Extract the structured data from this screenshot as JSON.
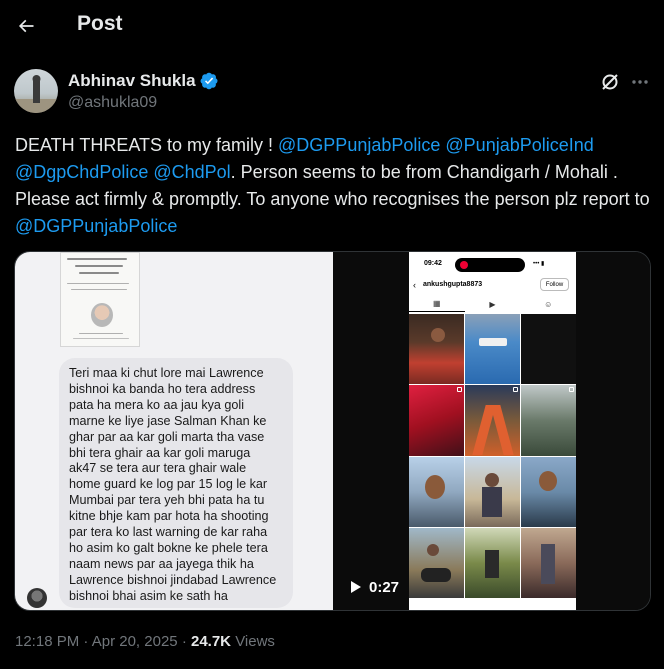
{
  "header": {
    "title": "Post",
    "back_icon": "arrow-left-icon"
  },
  "author": {
    "name": "Abhinav Shukla",
    "handle": "@ashukla09",
    "verified": true
  },
  "tweet": {
    "text_segments": [
      {
        "text": "DEATH THREATS to my family ! ",
        "mention": false
      },
      {
        "text": "@DGPPunjabPolice",
        "mention": true
      },
      {
        "text": " ",
        "mention": false
      },
      {
        "text": "@PunjabPoliceInd",
        "mention": true
      },
      {
        "text": " ",
        "mention": false
      },
      {
        "text": "@DgpChdPolice",
        "mention": true
      },
      {
        "text": " ",
        "mention": false
      },
      {
        "text": "@ChdPol",
        "mention": true
      },
      {
        "text": ". Person seems to be from Chandigarh / Mohali . Please act firmly & promptly.  To anyone who recognises the person plz report to ",
        "mention": false
      },
      {
        "text": "@DGPPunjabPolice",
        "mention": true
      }
    ]
  },
  "media": {
    "chat_message": "Teri maa ki chut lore mai Lawrence\nbishnoi ka banda ho tera address\npata ha mera ko aa jau kya goli\nmarne ke liye jase Salman Khan ke\nghar par aa kar goli marta tha vase\nbhi tera ghair aa kar goli maruga\nak47 se tera aur tera ghair wale\nhome guard ke log par 15 log le kar\nMumbai par tera yeh bhi pata ha tu\nkitne bhje kam par hota ha shooting\npar tera ko last warning de kar raha\nho asim ko galt bokne ke phele tera\nnaam news par aa jayega thik ha\nLawrence bishnoi jindabad Lawrence\nbishnoi bhai asim ke sath ha",
    "phone_time": "09:42",
    "status_icons": "••• ▮",
    "profile_username": "ankushgupta8873",
    "follow_label": "Follow",
    "video_duration": "0:27"
  },
  "meta": {
    "time": "12:18 PM",
    "date": "Apr 20, 2025",
    "views_count": "24.7K",
    "views_label": "Views",
    "separator": "·"
  }
}
